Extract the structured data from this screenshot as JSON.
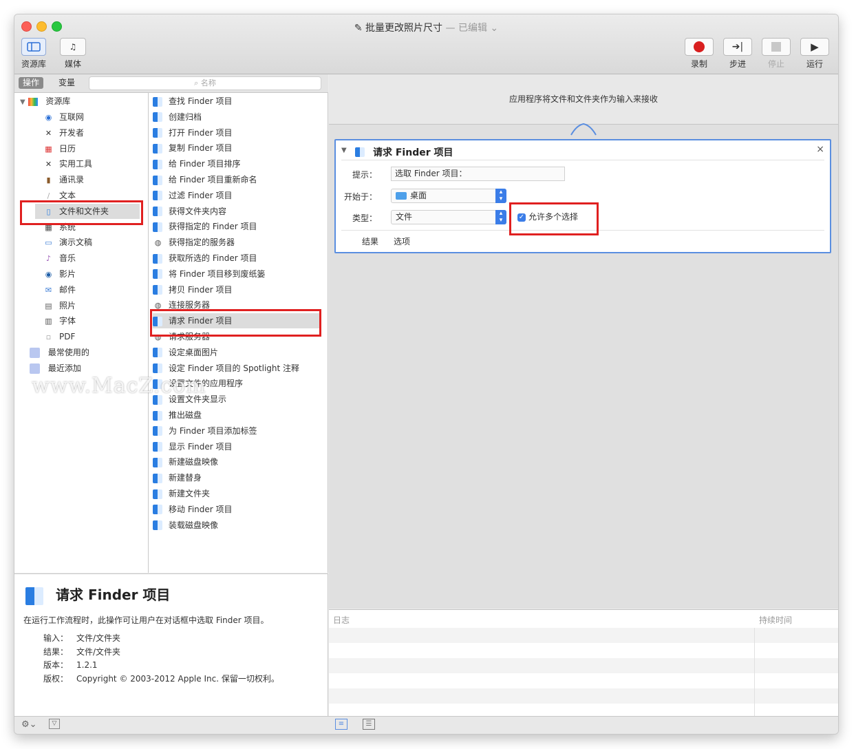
{
  "window": {
    "title": "批量更改照片尺寸",
    "edited": "— 已编辑",
    "edited_chevron": "⌄"
  },
  "toolbar": {
    "library_label": "资源库",
    "media_label": "媒体",
    "record_label": "录制",
    "step_label": "步进",
    "stop_label": "停止",
    "run_label": "运行"
  },
  "panel": {
    "actions_tab": "操作",
    "variables_tab": "变量",
    "search_placeholder": "名称"
  },
  "library": {
    "root": "资源库",
    "items": [
      "互联网",
      "开发者",
      "日历",
      "实用工具",
      "通讯录",
      "文本",
      "文件和文件夹",
      "系统",
      "演示文稿",
      "音乐",
      "影片",
      "邮件",
      "照片",
      "字体",
      "PDF"
    ],
    "most_used": "最常使用的",
    "recently_added": "最近添加"
  },
  "actions": [
    "查找 Finder 项目",
    "创建归档",
    "打开 Finder 项目",
    "复制 Finder 项目",
    "给 Finder 项目排序",
    "给 Finder 项目重新命名",
    "过滤 Finder 项目",
    "获得文件夹内容",
    "获得指定的 Finder 项目",
    "获得指定的服务器",
    "获取所选的 Finder 项目",
    "将 Finder 项目移到废纸篓",
    "拷贝 Finder 项目",
    "连接服务器",
    "请求 Finder 项目",
    "请求服务器",
    "设定桌面图片",
    "设定 Finder 项目的 Spotlight 注释",
    "设置文件的应用程序",
    "设置文件夹显示",
    "推出磁盘",
    "为 Finder 项目添加标签",
    "显示 Finder 项目",
    "新建磁盘映像",
    "新建替身",
    "新建文件夹",
    "移动 Finder 项目",
    "装载磁盘映像"
  ],
  "description": {
    "title": "请求 Finder 项目",
    "text": "在运行工作流程时，此操作可让用户在对话框中选取 Finder 项目。",
    "input_label": "输入：",
    "input_value": "文件/文件夹",
    "result_label": "结果：",
    "result_value": "文件/文件夹",
    "version_label": "版本：",
    "version_value": "1.2.1",
    "copyright_label": "版权：",
    "copyright_value": "Copyright © 2003-2012 Apple Inc. 保留一切权利。"
  },
  "workflow": {
    "header": "应用程序将文件和文件夹作为输入来接收",
    "card": {
      "title": "请求 Finder 项目",
      "prompt_label": "提示：",
      "prompt_value": "选取 Finder 项目：",
      "start_label": "开始于：",
      "start_value": "桌面",
      "type_label": "类型：",
      "type_value": "文件",
      "allow_multiple": "允许多个选择",
      "allow_multiple_checked": true,
      "results_label": "结果",
      "options_label": "选项",
      "close": "×"
    }
  },
  "log": {
    "log_label": "日志",
    "duration_label": "持续时间"
  },
  "watermark": "www.MacZ.com",
  "colors": {
    "highlight": "#e02020",
    "accent": "#3b7de8",
    "record": "#d81e1e"
  }
}
